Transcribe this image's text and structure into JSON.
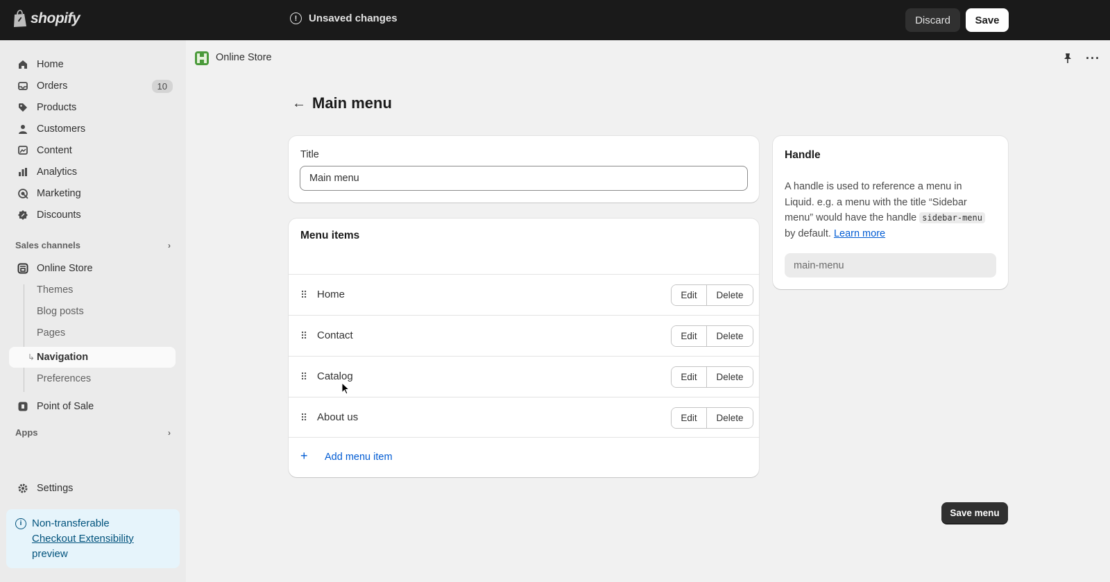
{
  "topbar": {
    "logo_text": "shopify",
    "status_text": "Unsaved changes",
    "discard_label": "Discard",
    "save_label": "Save"
  },
  "sidebar": {
    "items": [
      {
        "label": "Home",
        "icon": "home-icon"
      },
      {
        "label": "Orders",
        "icon": "inbox-icon",
        "badge": "10"
      },
      {
        "label": "Products",
        "icon": "tag-icon"
      },
      {
        "label": "Customers",
        "icon": "person-icon"
      },
      {
        "label": "Content",
        "icon": "image-icon"
      },
      {
        "label": "Analytics",
        "icon": "bar-chart-icon"
      },
      {
        "label": "Marketing",
        "icon": "target-icon"
      },
      {
        "label": "Discounts",
        "icon": "discount-icon"
      }
    ],
    "sales_channels_label": "Sales channels",
    "online_store_label": "Online Store",
    "sub_items": [
      "Themes",
      "Blog posts",
      "Pages",
      "Navigation",
      "Preferences"
    ],
    "active_sub_item": "Navigation",
    "point_of_sale_label": "Point of Sale",
    "apps_label": "Apps",
    "settings_label": "Settings",
    "banner": {
      "line1": "Non-transferable",
      "link": "Checkout Extensibility",
      "line3": "preview"
    }
  },
  "header": {
    "store_name": "Online Store"
  },
  "page": {
    "title": "Main menu"
  },
  "title_card": {
    "label": "Title",
    "value": "Main menu"
  },
  "menu_card": {
    "heading": "Menu items",
    "rows": [
      {
        "label": "Home"
      },
      {
        "label": "Contact"
      },
      {
        "label": "Catalog"
      },
      {
        "label": "About us"
      }
    ],
    "edit_label": "Edit",
    "delete_label": "Delete",
    "add_label": "Add menu item"
  },
  "handle_card": {
    "heading": "Handle",
    "desc_part1": "A handle is used to reference a menu in Liquid. e.g. a menu with the title “Sidebar menu” would have the handle ",
    "desc_code": "sidebar-menu",
    "desc_part2": " by default. ",
    "learn_more": "Learn more",
    "value": "main-menu"
  },
  "save_menu_label": "Save menu",
  "colors": {
    "topbar_bg": "#1a1a1a",
    "sidebar_bg": "#ebebeb",
    "main_bg": "#f1f1f1",
    "link_blue": "#005bd3",
    "primary_button": "#303030"
  }
}
